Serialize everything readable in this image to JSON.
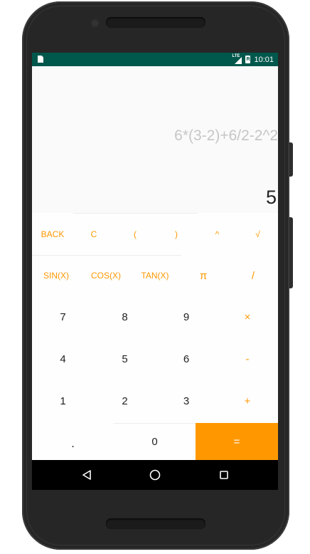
{
  "status_bar": {
    "network": "LTE",
    "battery_glyph": "R",
    "time": "10:01"
  },
  "display": {
    "expression": "6*(3-2)+6/2-2^2",
    "result": "5"
  },
  "keypad": {
    "back": "BACK",
    "clear": "C",
    "open_paren": "(",
    "close_paren": ")",
    "power": "^",
    "sqrt": "√",
    "sin": "SIN(X)",
    "cos": "COS(X)",
    "tan": "TAN(X)",
    "pi": "π",
    "divide": "/",
    "seven": "7",
    "eight": "8",
    "nine": "9",
    "multiply": "×",
    "four": "4",
    "five": "5",
    "six": "6",
    "minus": "-",
    "one": "1",
    "two": "2",
    "three": "3",
    "plus": "+",
    "dot": ".",
    "zero": "0",
    "equals": "="
  },
  "colors": {
    "accent": "#ff9800",
    "status_bar": "#00574b",
    "nav_bar": "#000000",
    "phone_body": "#262626"
  },
  "icons": {
    "nav_back": "back-triangle-icon",
    "nav_home": "home-circle-icon",
    "nav_recents": "recents-square-icon"
  }
}
